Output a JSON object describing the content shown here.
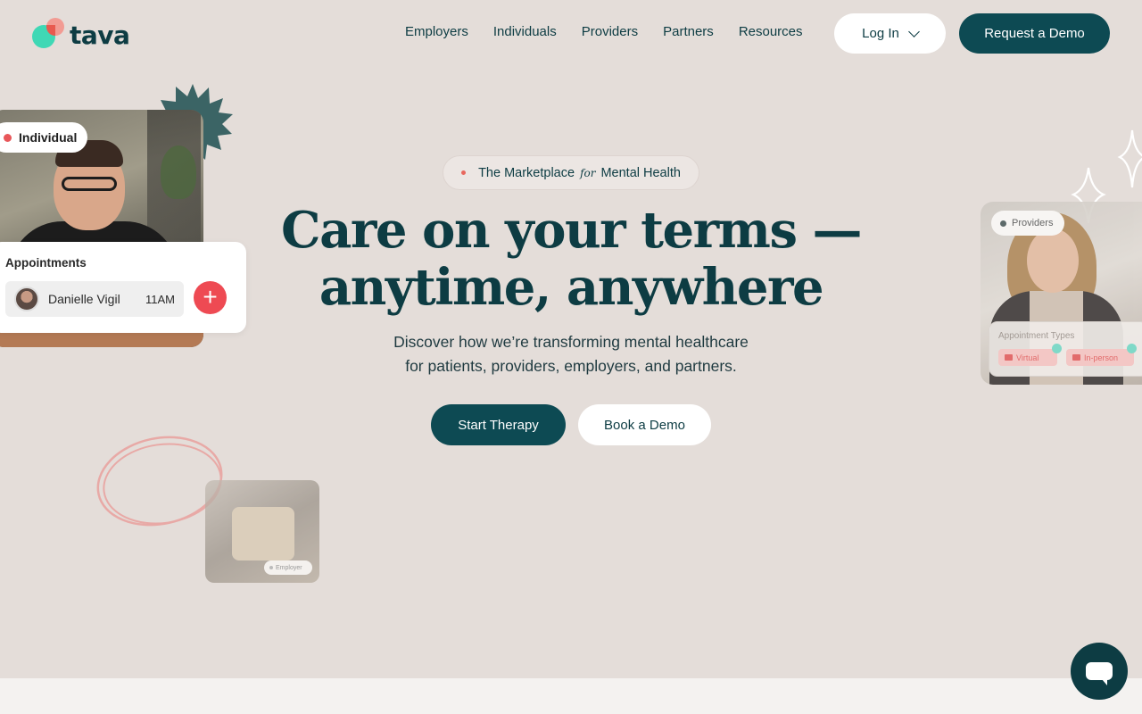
{
  "brand": {
    "name": "tava"
  },
  "nav": {
    "items": [
      "Employers",
      "Individuals",
      "Providers",
      "Partners",
      "Resources"
    ],
    "login_label": "Log In",
    "demo_label": "Request a Demo"
  },
  "hero": {
    "pill_prefix": "The Marketplace",
    "pill_italic": "for",
    "pill_suffix": "Mental Health",
    "headline_line1": "Care on your terms —",
    "headline_line2": "anytime, anywhere",
    "subhead_line1": "Discover how we’re transforming mental healthcare",
    "subhead_line2": "for patients, providers, employers, and partners.",
    "primary_cta": "Start Therapy",
    "secondary_cta": "Book a Demo"
  },
  "collage_left": {
    "badge": "Individual",
    "appointments_title": "Appointments",
    "appointment_name": "Danielle Vigil",
    "appointment_time": "11AM",
    "add_symbol": "+",
    "employer_badge": "Employer"
  },
  "collage_right": {
    "badge": "Providers",
    "types_title": "Appointment Types",
    "type_virtual": "Virtual",
    "type_inperson": "In-person"
  },
  "colors": {
    "background": "#e4ddd9",
    "primary": "#0d4a53",
    "accent": "#e8575a",
    "logo_teal": "#3fd8b5",
    "logo_pink": "#f29b93"
  },
  "icons": {
    "login_chevron": "chevron-down-icon",
    "add_appointment": "plus-icon",
    "chat": "chat-icon"
  }
}
